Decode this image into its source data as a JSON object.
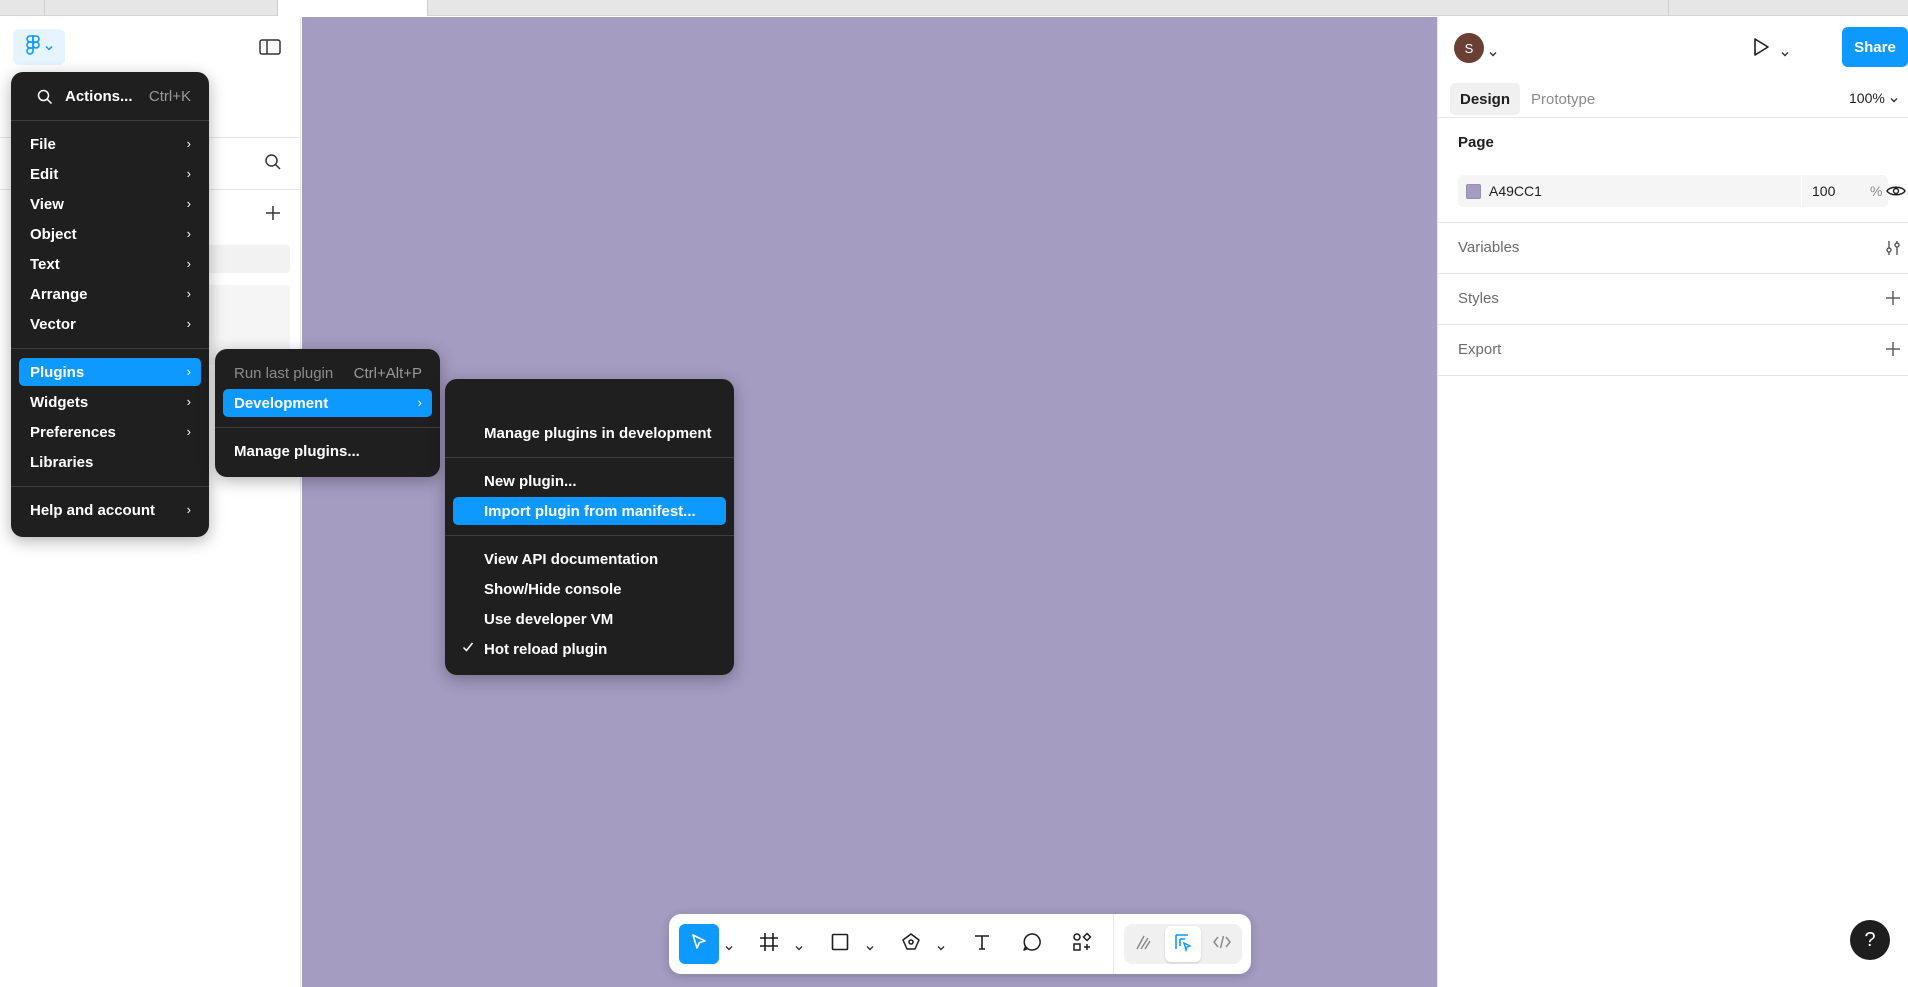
{
  "colors": {
    "canvas": "#A49CC1",
    "accent": "#0D99FF",
    "menu_bg": "#1F1F1F"
  },
  "app_menu": {
    "search_label": "Actions...",
    "search_shortcut": "Ctrl+K",
    "items": [
      {
        "label": "File",
        "submenu": true
      },
      {
        "label": "Edit",
        "submenu": true
      },
      {
        "label": "View",
        "submenu": true
      },
      {
        "label": "Object",
        "submenu": true
      },
      {
        "label": "Text",
        "submenu": true
      },
      {
        "label": "Arrange",
        "submenu": true
      },
      {
        "label": "Vector",
        "submenu": true
      },
      {
        "label": "Plugins",
        "submenu": true,
        "highlighted": true
      },
      {
        "label": "Widgets",
        "submenu": true
      },
      {
        "label": "Preferences",
        "submenu": true
      },
      {
        "label": "Libraries",
        "submenu": false
      },
      {
        "label": "Help and account",
        "submenu": true
      }
    ]
  },
  "plugins_menu": {
    "run_last": "Run last plugin",
    "run_last_shortcut": "Ctrl+Alt+P",
    "development": "Development",
    "manage": "Manage plugins..."
  },
  "development_menu": {
    "manage_in_dev": "Manage plugins in development",
    "new_plugin": "New plugin...",
    "import_manifest": "Import plugin from manifest...",
    "api_docs": "View API documentation",
    "console": "Show/Hide console",
    "developer_vm": "Use developer VM",
    "hot_reload": "Hot reload plugin",
    "hot_reload_checked": true
  },
  "right_panel": {
    "avatar_initial": "S",
    "share_label": "Share",
    "tabs": [
      "Design",
      "Prototype"
    ],
    "active_tab": "Design",
    "zoom": "100%",
    "page_section": "Page",
    "fill_hex": "A49CC1",
    "fill_opacity": "100",
    "fill_unit": "%",
    "variables": "Variables",
    "styles": "Styles",
    "export": "Export"
  },
  "toolbar": {
    "tools": [
      "move-tool",
      "frame-tool",
      "shape-tool",
      "pen-tool",
      "text-tool",
      "comment-tool",
      "actions-tool"
    ],
    "selected": "move-tool",
    "modes": [
      "draw-mode",
      "design-mode",
      "dev-mode"
    ],
    "active_mode": "design-mode"
  },
  "help_label": "?"
}
